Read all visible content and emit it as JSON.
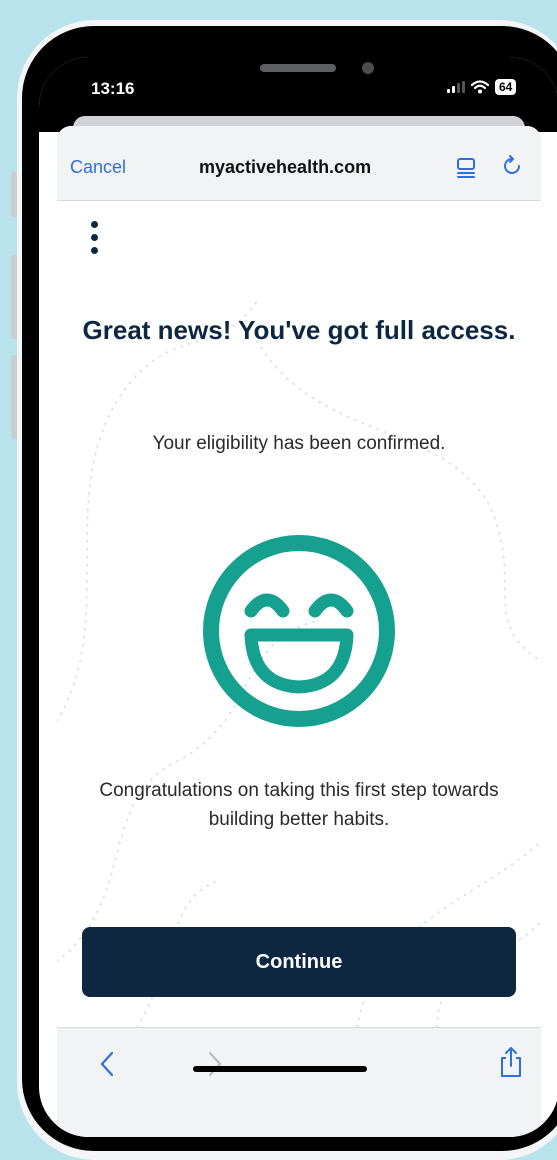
{
  "status_bar": {
    "time": "13:16",
    "battery": "64",
    "icons": [
      "signal-icon",
      "wifi-icon",
      "battery-icon"
    ]
  },
  "browser": {
    "cancel_label": "Cancel",
    "domain": "myactivehealth.com",
    "icons": [
      "reader-mode-icon",
      "reload-icon"
    ]
  },
  "page": {
    "menu_icon": "kebab-menu-icon",
    "headline": "Great news! You've got full access.",
    "subtext": "Your eligibility has been confirmed.",
    "illustration_icon": "grinning-smiley-icon",
    "congrats": "Congratulations on taking this first step towards building better habits.",
    "continue_label": "Continue"
  },
  "toolbar": {
    "icons": [
      "back-icon",
      "forward-icon",
      "share-icon"
    ]
  },
  "colors": {
    "background": "#b8e2ec",
    "navy": "#0e2741",
    "teal": "#15a08f",
    "link_blue": "#2f6fdd"
  }
}
